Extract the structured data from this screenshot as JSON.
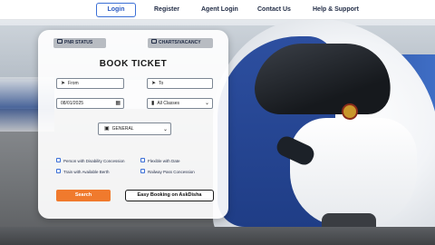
{
  "nav": {
    "login": "Login",
    "register": "Register",
    "agent_login": "Agent Login",
    "contact_us": "Contact Us",
    "help_support": "Help & Support"
  },
  "tabs": {
    "pnr_status": "PNR STATUS",
    "charts_vacancy": "CHARTS/VACANCY"
  },
  "form": {
    "title": "BOOK TICKET",
    "from_placeholder": "From",
    "to_placeholder": "To",
    "date_value": "08/01/2025",
    "class_value": "All Classes",
    "quota_value": "GENERAL",
    "checkboxes": [
      "Person with Disability Concession",
      "Flexible with Date",
      "Train with Available Berth",
      "Railway Pass Concession"
    ],
    "search_label": "Search",
    "askdisha_label": "Easy Booking on AskDisha"
  },
  "icons": {
    "from": "location-arrow-icon",
    "to": "location-arrow-icon",
    "date": "calendar-icon",
    "class": "train-class-icon",
    "quota": "briefcase-icon"
  },
  "colors": {
    "accent": "#3b6fd6",
    "search_button": "#f07a2d"
  }
}
